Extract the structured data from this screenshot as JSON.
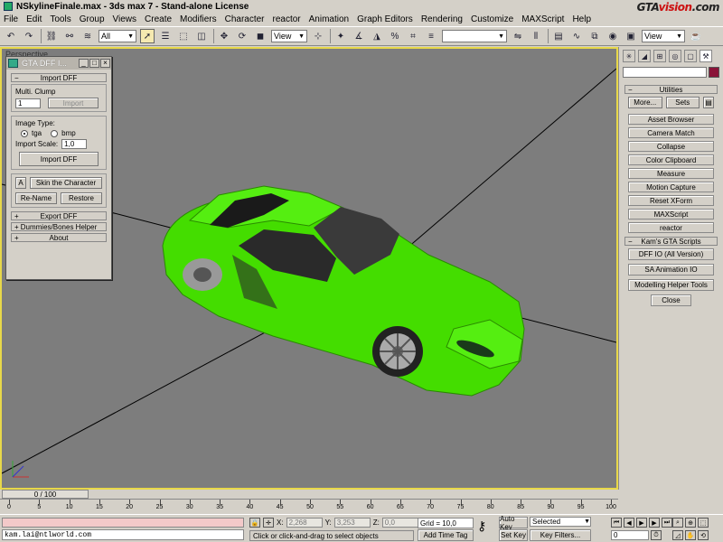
{
  "window": {
    "title": "NSkylineFinale.max - 3ds max 7 - Stand-alone License",
    "watermark": "GTAvision.com"
  },
  "menu": [
    "File",
    "Edit",
    "Tools",
    "Group",
    "Views",
    "Create",
    "Modifiers",
    "Character",
    "reactor",
    "Animation",
    "Graph Editors",
    "Rendering",
    "Customize",
    "MAXScript",
    "Help"
  ],
  "toolbar": {
    "selection_filter": "All",
    "ref_coord": "View",
    "named_selection": "",
    "render_view": "View"
  },
  "viewport": {
    "label": "Perspective",
    "border_color": "#e8d84a",
    "background": "#7d7d7d",
    "model_color": "#44dd00"
  },
  "dff_window": {
    "title": "GTA DFF I...",
    "rollout_import": "Import DFF",
    "multi_clump_label": "Multi. Clump",
    "clump_value": "1",
    "import_small": "Import",
    "image_type_label": "Image Type:",
    "radio_tga": "tga",
    "radio_bmp": "bmp",
    "import_scale_label": "Import Scale:",
    "import_scale_value": "1,0",
    "import_button": "Import DFF",
    "a_button": "A",
    "skin_button": "Skin the Character",
    "rename_button": "Re-Name",
    "restore_button": "Restore",
    "rollout_export": "Export DFF",
    "rollout_dummies": "Dummies/Bones Helper",
    "rollout_about": "About"
  },
  "command_panel": {
    "color_swatch": "#8a1338",
    "utilities_rollout": "Utilities",
    "more_button": "More...",
    "sets_button": "Sets",
    "utilities": [
      "Asset Browser",
      "Camera Match",
      "Collapse",
      "Color Clipboard",
      "Measure",
      "Motion Capture",
      "Reset XForm",
      "MAXScript",
      "reactor"
    ],
    "kams_rollout": "Kam's GTA Scripts",
    "kams": [
      "DFF IO (All Version)",
      "SA Animation IO",
      "Modelling Helper Tools",
      "Close"
    ]
  },
  "timeline": {
    "frame": "0 / 100",
    "ticks": [
      "0",
      "5",
      "10",
      "15",
      "20",
      "25",
      "30",
      "35",
      "40",
      "45",
      "50",
      "55",
      "60",
      "65",
      "70",
      "75",
      "80",
      "85",
      "90",
      "95",
      "100"
    ]
  },
  "status": {
    "listener_text": "kam.lai@ntlworld.com",
    "x_label": "X:",
    "x_value": "2,268",
    "y_label": "Y:",
    "y_value": "3,253",
    "z_label": "Z:",
    "z_value": "0,0",
    "grid": "Grid = 10,0",
    "prompt": "Click or click-and-drag to select objects",
    "add_time_tag": "Add Time Tag",
    "auto_key": "Auto Key",
    "set_key": "Set Key",
    "key_mode": "Selected",
    "key_filters": "Key Filters...",
    "frame_field": "0"
  }
}
